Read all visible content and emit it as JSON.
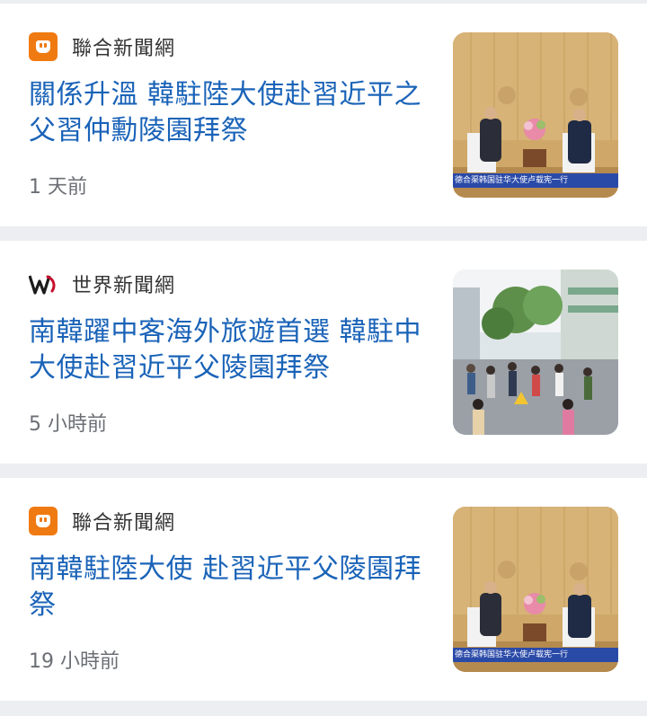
{
  "feed": {
    "articles": [
      {
        "source": "聯合新聞網",
        "source_logo": "udn-plug-icon",
        "headline": "關係升溫 韓駐陸大使赴習近平之父習仲勳陵園拜祭",
        "time": "1 天前",
        "thumbnail": "meeting-photo",
        "caption": "德合渠韩国驻华大使卢载宪一行"
      },
      {
        "source": "世界新聞網",
        "source_logo": "world-journal-w-icon",
        "headline": "南韓躍中客海外旅遊首選 韓駐中大使赴習近平父陵園拜祭",
        "time": "5 小時前",
        "thumbnail": "street-crowd-photo"
      },
      {
        "source": "聯合新聞網",
        "source_logo": "udn-plug-icon",
        "headline": "南韓駐陸大使 赴習近平父陵園拜祭",
        "time": "19 小時前",
        "thumbnail": "meeting-photo",
        "caption": "德合渠韩国驻华大使卢载宪一行"
      }
    ]
  },
  "colors": {
    "headline": "#1a63b8",
    "udn_orange": "#f07a12",
    "wj_red": "#c8102e",
    "background": "#eceef1"
  }
}
